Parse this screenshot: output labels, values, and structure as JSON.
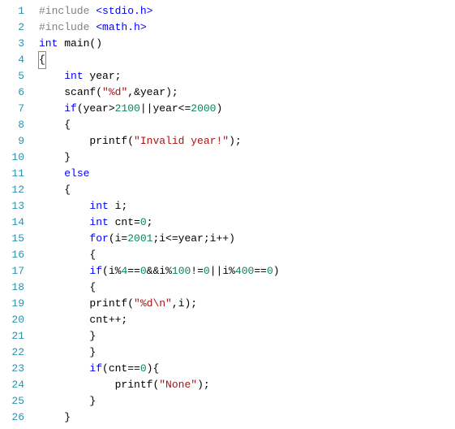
{
  "gutter": {
    "lines": [
      "1",
      "2",
      "3",
      "4",
      "5",
      "6",
      "7",
      "8",
      "9",
      "10",
      "11",
      "12",
      "13",
      "14",
      "15",
      "16",
      "17",
      "18",
      "19",
      "20",
      "21",
      "22",
      "23",
      "24",
      "25",
      "26"
    ]
  },
  "code": {
    "l1_pp": "#include ",
    "l1_hdr": "<stdio.h>",
    "l2_pp": "#include ",
    "l2_hdr": "<math.h>",
    "l3_kw1": "int",
    "l3_id": " main",
    "l3_p": "()",
    "l4_b": "{",
    "l5_kw": "int",
    "l5_id": " year",
    "l5_p": ";",
    "l6_id": "scanf",
    "l6_p1": "(",
    "l6_str": "\"%d\"",
    "l6_p2": ",&year);",
    "l7_kw": "if",
    "l7_p1": "(year>",
    "l7_n1": "2100",
    "l7_p2": "||year<=",
    "l7_n2": "2000",
    "l7_p3": ")",
    "l8_b": "{",
    "l9_id": "printf",
    "l9_p1": "(",
    "l9_str": "\"Invalid year!\"",
    "l9_p2": ");",
    "l10_b": "}",
    "l11_kw": "else",
    "l12_b": "{",
    "l13_kw": "int",
    "l13_id": " i",
    "l13_p": ";",
    "l14_kw": "int",
    "l14_id": " cnt=",
    "l14_n": "0",
    "l14_p": ";",
    "l15_kw": "for",
    "l15_p1": "(i=",
    "l15_n1": "2001",
    "l15_p2": ";i<=year;i++)",
    "l16_b": "{",
    "l17_kw": "if",
    "l17_p1": "(i%",
    "l17_n1": "4",
    "l17_p2": "==",
    "l17_n2": "0",
    "l17_p3": "&&i%",
    "l17_n3": "100",
    "l17_p4": "!=",
    "l17_n4": "0",
    "l17_p5": "||i%",
    "l17_n5": "400",
    "l17_p6": "==",
    "l17_n6": "0",
    "l17_p7": ")",
    "l18_b": "{",
    "l19_id": "printf",
    "l19_p1": "(",
    "l19_str": "\"%d\\n\"",
    "l19_p2": ",i);",
    "l20_id": "cnt++;",
    "l21_b": "}",
    "l22_b": "}",
    "l23_kw": "if",
    "l23_p1": "(cnt==",
    "l23_n": "0",
    "l23_p2": "){",
    "l24_id": "printf",
    "l24_p1": "(",
    "l24_str": "\"None\"",
    "l24_p2": ");",
    "l25_b": "}",
    "l26_b": "}"
  }
}
